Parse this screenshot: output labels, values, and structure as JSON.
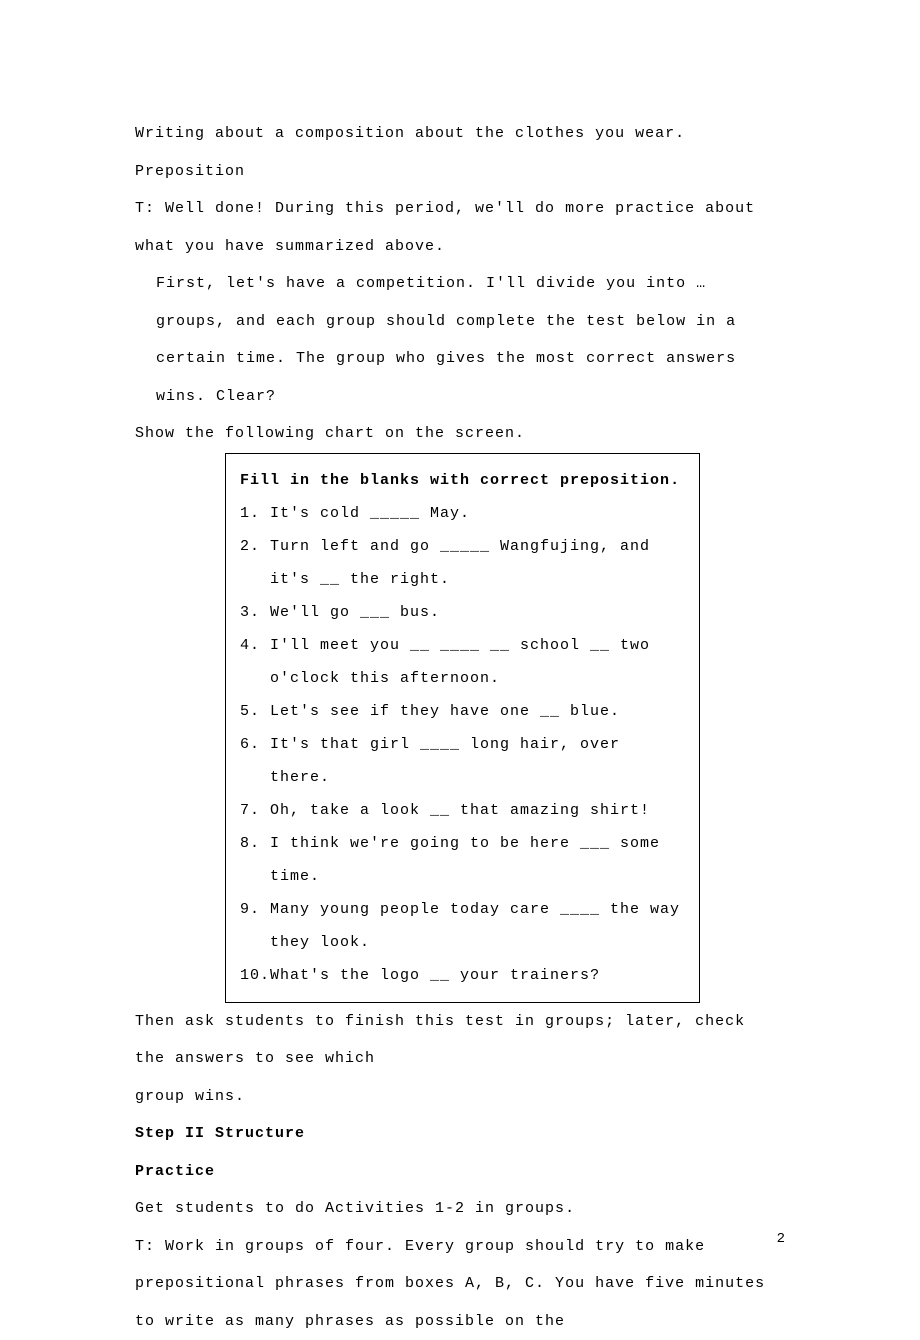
{
  "p1": "Writing about a composition about the clothes you wear.",
  "p2": "Preposition",
  "p3": "T: Well done! During this period, we'll do more practice about what you have summarized above.",
  "p4": "First, let's have a competition. I'll divide you into … groups, and each group should complete the test below in a certain time. The group who gives the most correct answers wins. Clear?",
  "p5": "Show the following chart on the screen.",
  "chart": {
    "title": "Fill in the blanks with correct preposition.",
    "items": [
      "It's cold _____ May.",
      "Turn left and go _____ Wangfujing, and it's __ the right.",
      "We'll go ___ bus.",
      "I'll meet you __ ____ __ school __ two o'clock this afternoon.",
      "Let's see if they have one __ blue.",
      "It's that girl ____ long hair, over there.",
      "Oh, take a look __ that amazing shirt!",
      "I think we're going to be here ___ some time.",
      "Many young people today care ____ the way they look.",
      "What's the logo __ your trainers?"
    ]
  },
  "p6a": "Then ask students to finish this test in groups; later, check the answers to see which",
  "p6b": "group wins.",
  "h1": "Step II Structure",
  "h2": "Practice",
  "p7": "Get students to do Activities 1-2 in groups.",
  "p8": "T: Work in groups of four. Every group should try to make prepositional phrases from boxes A, B, C. You have five minutes to write as many phrases as possible on the",
  "page_number": "2"
}
